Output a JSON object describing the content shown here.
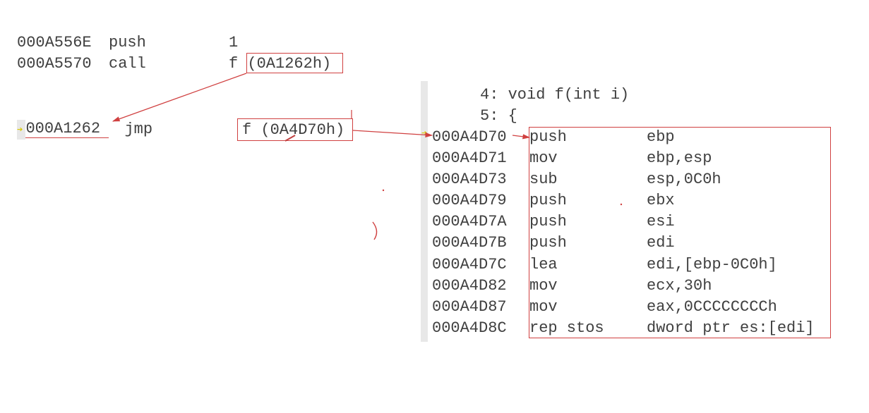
{
  "caller": {
    "rows": [
      {
        "addr": "000A556E",
        "mnem": "push",
        "oper": "1"
      },
      {
        "addr": "000A5570",
        "mnem": "call",
        "oper": "f (0A1262h)"
      }
    ]
  },
  "thunk": {
    "addr": "000A1262",
    "mnem": "jmp",
    "oper": "f (0A4D70h)"
  },
  "source": {
    "line4": "    4: void f(int i)",
    "line5": "    5: {"
  },
  "function_body": {
    "rows": [
      {
        "addr": "000A4D70",
        "mnem": "push",
        "oper": "ebp"
      },
      {
        "addr": "000A4D71",
        "mnem": "mov",
        "oper": "ebp,esp"
      },
      {
        "addr": "000A4D73",
        "mnem": "sub",
        "oper": "esp,0C0h"
      },
      {
        "addr": "000A4D79",
        "mnem": "push",
        "oper": "ebx"
      },
      {
        "addr": "000A4D7A",
        "mnem": "push",
        "oper": "esi"
      },
      {
        "addr": "000A4D7B",
        "mnem": "push",
        "oper": "edi"
      },
      {
        "addr": "000A4D7C",
        "mnem": "lea",
        "oper": "edi,[ebp-0C0h]"
      },
      {
        "addr": "000A4D82",
        "mnem": "mov",
        "oper": "ecx,30h"
      },
      {
        "addr": "000A4D87",
        "mnem": "mov",
        "oper": "eax,0CCCCCCCCh"
      },
      {
        "addr": "000A4D8C",
        "mnem": "rep stos",
        "oper": "dword ptr es:[edi]"
      }
    ]
  },
  "annotations": {
    "box1_target": "(0A1262h)",
    "box2_target": "f (0A4D70h)"
  },
  "colors": {
    "box": "#d04040",
    "pointer": "#d8c800"
  }
}
